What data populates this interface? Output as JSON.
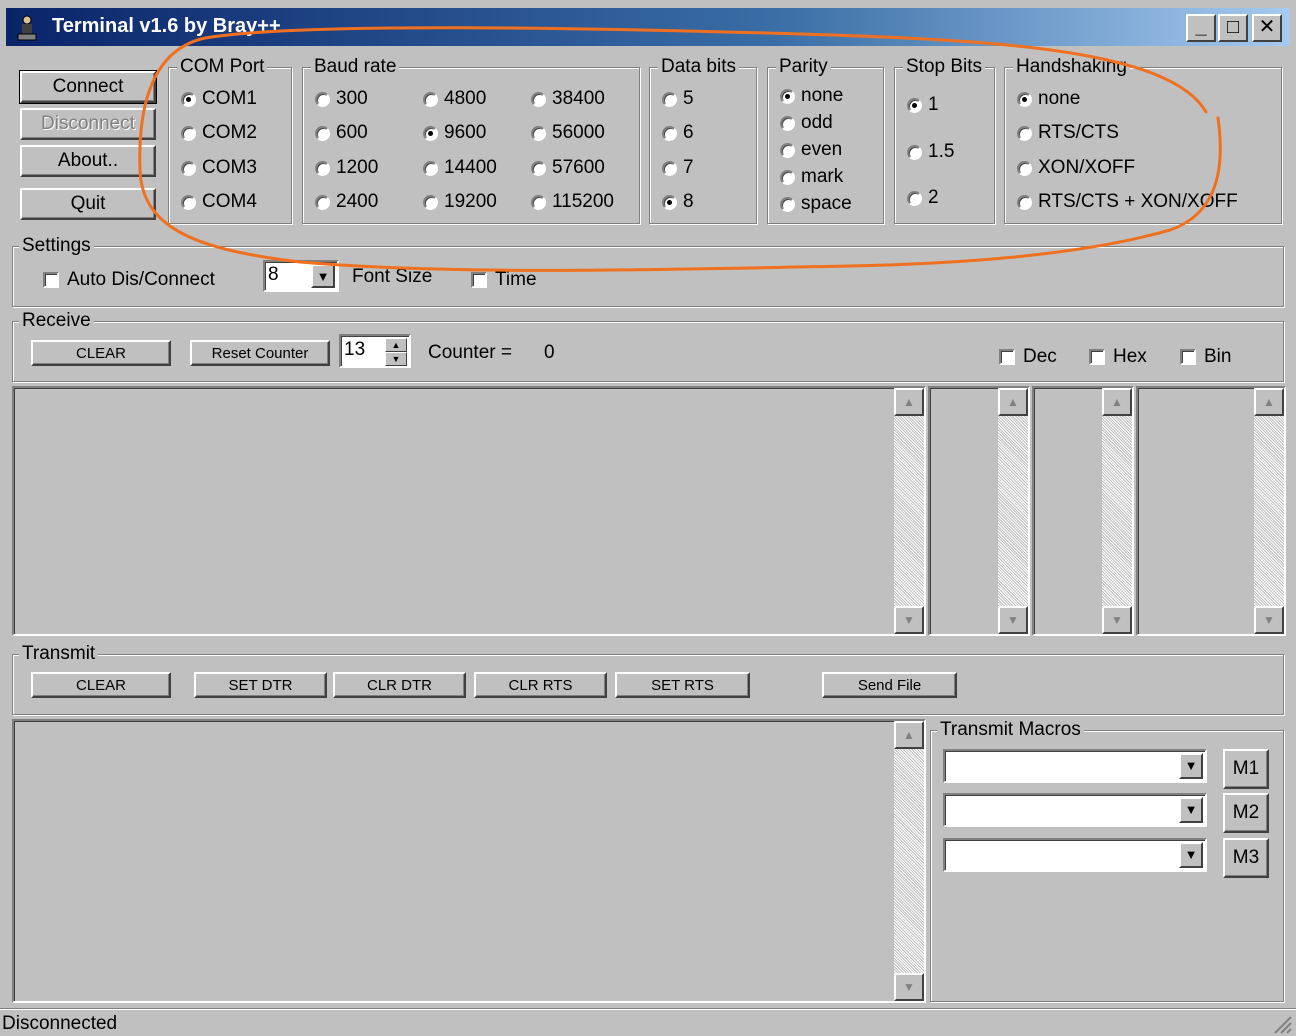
{
  "window": {
    "title": "Terminal v1.6  by Bray++",
    "min_label": "_",
    "max_label": "□",
    "close_label": "✕"
  },
  "left_buttons": {
    "connect": "Connect",
    "disconnect": "Disconnect",
    "about": "About..",
    "quit": "Quit"
  },
  "com_port": {
    "label": "COM Port",
    "options": [
      "COM1",
      "COM2",
      "COM3",
      "COM4"
    ],
    "selected": "COM1"
  },
  "baud_rate": {
    "label": "Baud rate",
    "options": [
      "300",
      "600",
      "1200",
      "2400",
      "4800",
      "9600",
      "14400",
      "19200",
      "38400",
      "56000",
      "57600",
      "115200"
    ],
    "selected": "9600"
  },
  "data_bits": {
    "label": "Data bits",
    "options": [
      "5",
      "6",
      "7",
      "8"
    ],
    "selected": "8"
  },
  "parity": {
    "label": "Parity",
    "options": [
      "none",
      "odd",
      "even",
      "mark",
      "space"
    ],
    "selected": "none"
  },
  "stop_bits": {
    "label": "Stop Bits",
    "options": [
      "1",
      "1.5",
      "2"
    ],
    "selected": "1"
  },
  "handshaking": {
    "label": "Handshaking",
    "options": [
      "none",
      "RTS/CTS",
      "XON/XOFF",
      "RTS/CTS + XON/XOFF"
    ],
    "selected": "none"
  },
  "settings": {
    "label": "Settings",
    "auto_label": "Auto Dis/Connect",
    "font_size_value": "8",
    "font_size_label": "Font Size",
    "time_label": "Time"
  },
  "receive": {
    "label": "Receive",
    "clear": "CLEAR",
    "reset_counter": "Reset Counter",
    "counter_spin": "13",
    "counter_label": "Counter =",
    "counter_value": "0",
    "dec": "Dec",
    "hex": "Hex",
    "bin": "Bin"
  },
  "transmit": {
    "label": "Transmit",
    "clear": "CLEAR",
    "set_dtr": "SET DTR",
    "clr_dtr": "CLR DTR",
    "clr_rts": "CLR RTS",
    "set_rts": "SET RTS",
    "send_file": "Send File"
  },
  "macros": {
    "label": "Transmit Macros",
    "m1": "M1",
    "m2": "M2",
    "m3": "M3"
  },
  "status": {
    "text": "Disconnected"
  },
  "colors": {
    "face": "#c0c0c0",
    "title_dark": "#0a246a",
    "annotation": "#f07020"
  },
  "icons": {
    "app": "terminal-person-icon",
    "scroll_up": "triangle-up-icon",
    "scroll_down": "triangle-down-icon",
    "dropdown": "triangle-down-icon"
  }
}
